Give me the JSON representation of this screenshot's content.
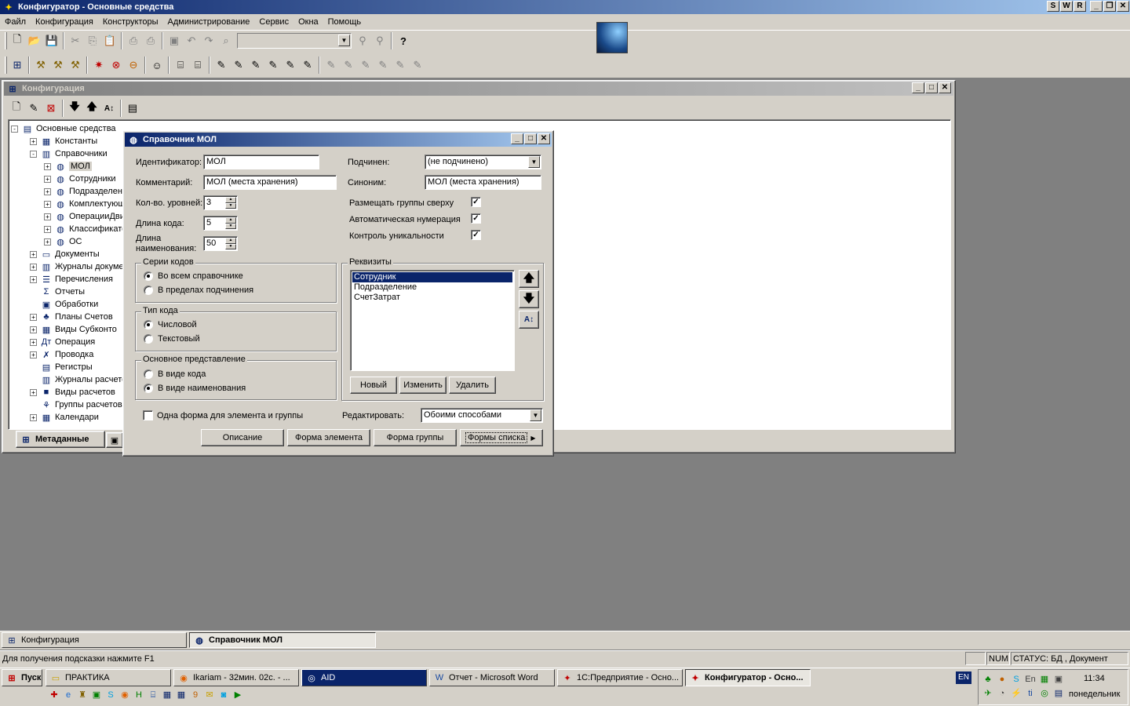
{
  "app": {
    "title": "Конфигуратор - Основные средства",
    "title_buttons": [
      "S",
      "W",
      "R"
    ]
  },
  "menu": [
    "Файл",
    "Конфигурация",
    "Конструкторы",
    "Администрирование",
    "Сервис",
    "Окна",
    "Помощь"
  ],
  "config_window": {
    "title": "Конфигурация",
    "tab_metadata": "Метаданные"
  },
  "tree": [
    {
      "label": "Основные средства",
      "level": 0,
      "pm": "-",
      "icon": "config-root-icon",
      "glyph": "▤"
    },
    {
      "label": "Константы",
      "level": 1,
      "pm": "+",
      "icon": "constants-icon",
      "glyph": "▦"
    },
    {
      "label": "Справочники",
      "level": 1,
      "pm": "-",
      "icon": "catalogs-icon",
      "glyph": "▥"
    },
    {
      "label": "МОЛ",
      "level": 2,
      "pm": "+",
      "icon": "catalog-icon",
      "glyph": "◍",
      "selected": true
    },
    {
      "label": "Сотрудники",
      "level": 2,
      "pm": "+",
      "icon": "catalog-icon",
      "glyph": "◍"
    },
    {
      "label": "Подразделения",
      "level": 2,
      "pm": "+",
      "icon": "catalog-icon",
      "glyph": "◍"
    },
    {
      "label": "Комплектующие",
      "level": 2,
      "pm": "+",
      "icon": "catalog-icon",
      "glyph": "◍"
    },
    {
      "label": "ОперацииДвижения",
      "level": 2,
      "pm": "+",
      "icon": "catalog-icon",
      "glyph": "◍"
    },
    {
      "label": "Классификатор",
      "level": 2,
      "pm": "+",
      "icon": "catalog-icon",
      "glyph": "◍"
    },
    {
      "label": "ОС",
      "level": 2,
      "pm": "+",
      "icon": "catalog-icon",
      "glyph": "◍"
    },
    {
      "label": "Документы",
      "level": 1,
      "pm": "+",
      "icon": "documents-folder-icon",
      "glyph": "▭"
    },
    {
      "label": "Журналы документов",
      "level": 1,
      "pm": "+",
      "icon": "journals-icon",
      "glyph": "▥"
    },
    {
      "label": "Перечисления",
      "level": 1,
      "pm": "+",
      "icon": "enums-icon",
      "glyph": "☰"
    },
    {
      "label": "Отчеты",
      "level": 1,
      "pm": "",
      "icon": "reports-icon",
      "glyph": "Σ"
    },
    {
      "label": "Обработки",
      "level": 1,
      "pm": "",
      "icon": "processing-icon",
      "glyph": "▣"
    },
    {
      "label": "Планы Счетов",
      "level": 1,
      "pm": "+",
      "icon": "accounts-plan-icon",
      "glyph": "♣"
    },
    {
      "label": "Виды Субконто",
      "level": 1,
      "pm": "+",
      "icon": "subconto-icon",
      "glyph": "▦"
    },
    {
      "label": "Операция",
      "level": 1,
      "pm": "+",
      "icon": "operation-icon",
      "glyph": "Дт"
    },
    {
      "label": "Проводка",
      "level": 1,
      "pm": "+",
      "icon": "entry-icon",
      "glyph": "✗"
    },
    {
      "label": "Регистры",
      "level": 1,
      "pm": "",
      "icon": "registers-icon",
      "glyph": "▤"
    },
    {
      "label": "Журналы расчетов",
      "level": 1,
      "pm": "",
      "icon": "calc-journals-icon",
      "glyph": "▥"
    },
    {
      "label": "Виды расчетов",
      "level": 1,
      "pm": "+",
      "icon": "calc-types-icon",
      "glyph": "■"
    },
    {
      "label": "Группы расчетов",
      "level": 1,
      "pm": "",
      "icon": "calc-groups-icon",
      "glyph": "⚘"
    },
    {
      "label": "Календари",
      "level": 1,
      "pm": "+",
      "icon": "calendars-icon",
      "glyph": "▦"
    }
  ],
  "dialog": {
    "title": "Справочник МОЛ",
    "identifier_label": "Идентификатор:",
    "identifier_value": "МОЛ",
    "comment_label": "Комментарий:",
    "comment_value": "МОЛ (места хранения)",
    "levels_label": "Кол-во. уровней:",
    "levels_value": "3",
    "code_length_label": "Длина кода:",
    "code_length_value": "5",
    "name_length_label_1": "Длина",
    "name_length_label_2": "наименования:",
    "name_length_value": "50",
    "subordinate_label": "Подчинен:",
    "subordinate_value": "(не подчинено)",
    "synonym_label": "Синоним:",
    "synonym_value": "МОЛ (места хранения)",
    "chk_groups_top": "Размещать группы сверху",
    "chk_auto_num": "Автоматическая нумерация",
    "chk_unique": "Контроль уникальности",
    "series_group": "Серии кодов",
    "series_opt1": "Во всем справочнике",
    "series_opt2": "В пределах подчинения",
    "codetype_group": "Тип кода",
    "codetype_opt1": "Числовой",
    "codetype_opt2": "Текстовый",
    "repr_group": "Основное представление",
    "repr_opt1": "В виде кода",
    "repr_opt2": "В виде наименования",
    "props_group": "Реквизиты",
    "props": [
      "Сотрудник",
      "Подразделение",
      "СчетЗатрат"
    ],
    "btn_new": "Новый",
    "btn_edit": "Изменить",
    "btn_delete": "Удалить",
    "one_form_label": "Одна форма для элемента и группы",
    "edit_label": "Редактировать:",
    "edit_value": "Обоими способами",
    "btn_description": "Описание",
    "btn_element_form": "Форма элемента",
    "btn_group_form": "Форма группы",
    "btn_list_forms": "Формы списка"
  },
  "mdi_tabs": [
    "Конфигурация",
    "Справочник МОЛ"
  ],
  "status": {
    "hint": "Для получения подсказки нажмите F1",
    "num": "NUM",
    "state": "СТАТУС: БД , Документ"
  },
  "taskbar": {
    "start": "Пуск",
    "items": [
      "ПРАКТИКА",
      "Ikariam - 32мин. 02с. - ...",
      "AID",
      "Отчет - Microsoft Word",
      "1С:Предприятие - Осно...",
      "Конфигуратор - Осно..."
    ],
    "lang": "EN",
    "time": "11:34",
    "day": "понедельник"
  },
  "colors": {
    "title_active": "#0a246a",
    "face": "#d4d0c8",
    "workspace": "#808080",
    "selection": "#0a246a"
  }
}
